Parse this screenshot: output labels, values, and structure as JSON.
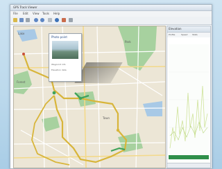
{
  "window": {
    "title": "GPS Track Viewer"
  },
  "menu": {
    "items": [
      "File",
      "Edit",
      "View",
      "Tools",
      "Help"
    ]
  },
  "toolbar": {
    "buttons": [
      "open-icon",
      "save-icon",
      "print-icon",
      "zoom-in-icon",
      "zoom-out-icon",
      "pan-icon",
      "globe-icon",
      "track-icon"
    ]
  },
  "map": {
    "labels": [
      "Park",
      "Lake",
      "Forest",
      "Town"
    ],
    "route_color": "#d8b53a",
    "highlight_color": "#3fa35a",
    "park_color": "#9fcf9a",
    "water_color": "#9ec3e6"
  },
  "popup": {
    "title": "Photo point",
    "line1": "Waypoint info",
    "line2": "Elevation data"
  },
  "panel": {
    "title": "Elevation",
    "tabs": [
      "Profile",
      "Speed",
      "Stats"
    ],
    "graph_color": "#cfe39a",
    "baseline_color": "#2f8f4a"
  }
}
